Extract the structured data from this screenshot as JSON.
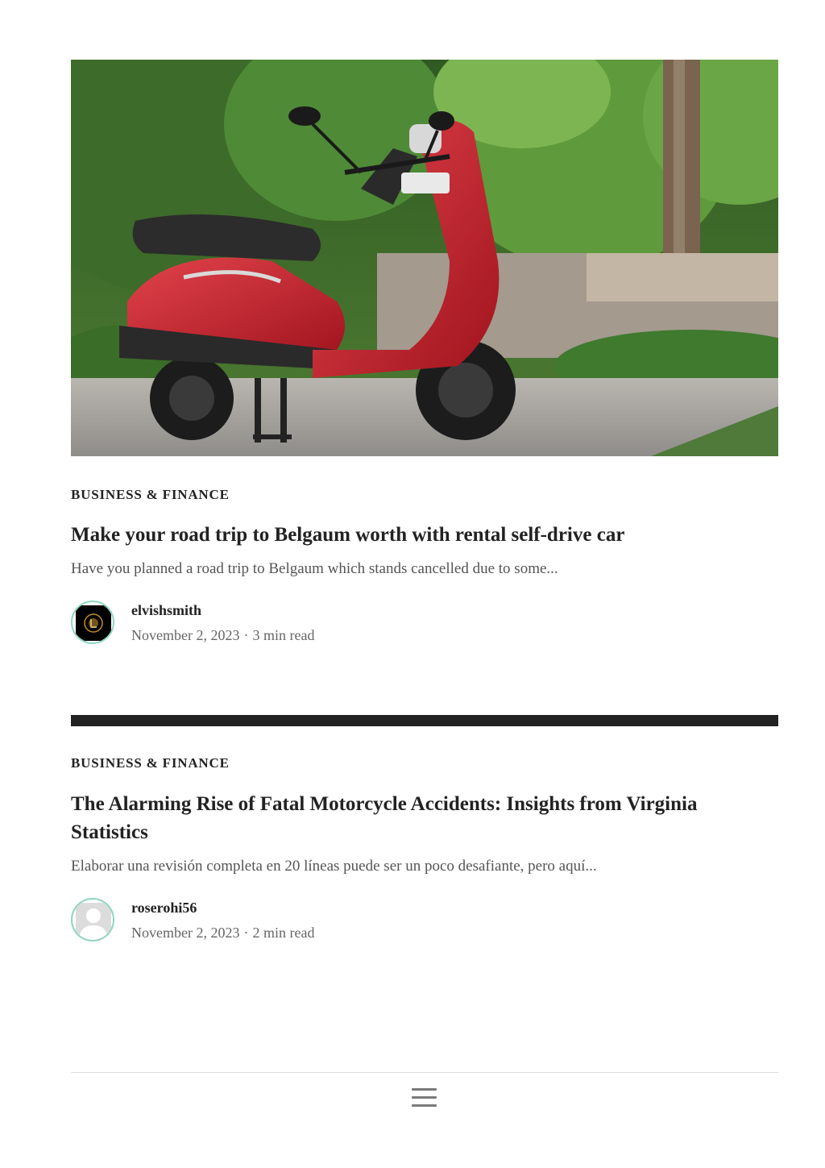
{
  "posts": [
    {
      "category": "BUSINESS & FINANCE",
      "title": "Make your road trip to Belgaum worth with rental self-drive car",
      "excerpt": "Have you planned a road trip to Belgaum which stands cancelled due to some...",
      "author": "elvishsmith",
      "date": "November 2, 2023",
      "separator": "·",
      "read_time": "3 min read",
      "image": "red-scooter-photo"
    },
    {
      "category": "BUSINESS & FINANCE",
      "title": "The Alarming Rise of Fatal Motorcycle Accidents: Insights from Virginia Statistics",
      "excerpt": "Elaborar una revisión completa en 20 líneas puede ser un poco desafiante, pero aquí...",
      "author": "roserohi56",
      "date": "November 2, 2023",
      "separator": "·",
      "read_time": "2 min read"
    }
  ],
  "footer": {
    "menu_icon": "hamburger-menu-icon"
  },
  "colors": {
    "text": "#222222",
    "excerpt": "#555555",
    "meta": "#666666",
    "avatar_ring": "#8fd6bd",
    "divider": "#222222"
  }
}
